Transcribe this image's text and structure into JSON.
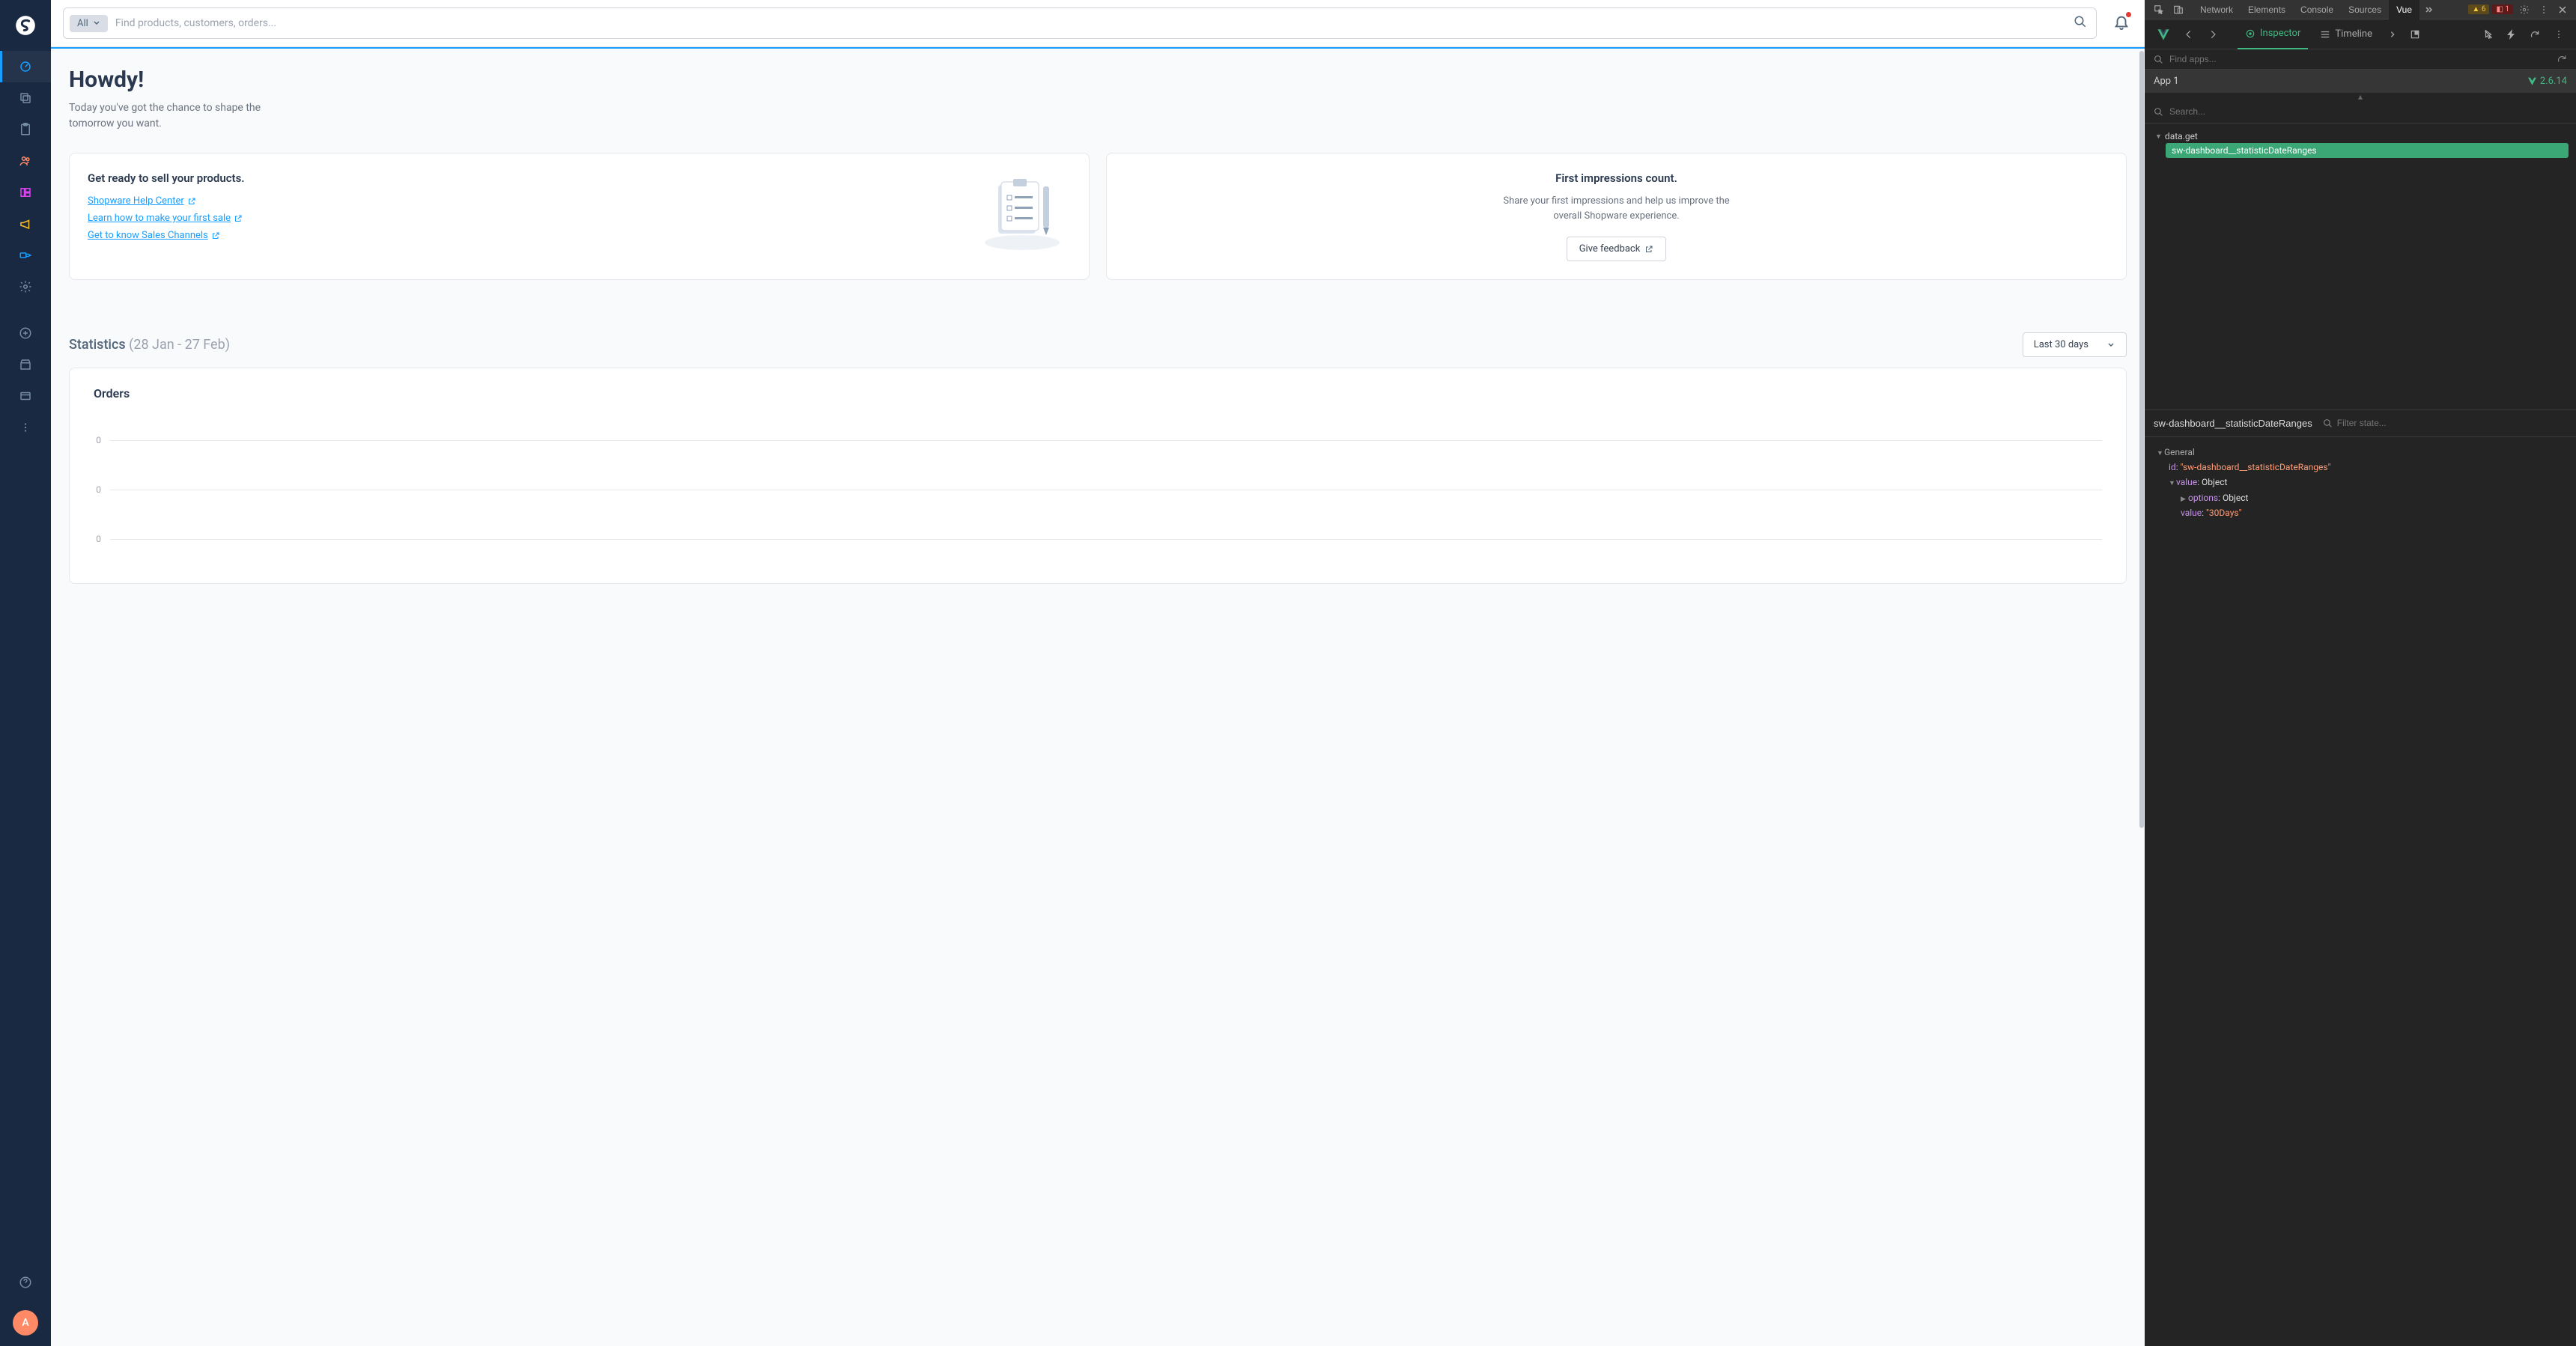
{
  "search": {
    "filter": "All",
    "placeholder": "Find products, customers, orders..."
  },
  "avatar": "A",
  "greeting": {
    "title": "Howdy!",
    "subtitle": "Today you've got the chance to shape the tomorrow you want."
  },
  "card_ready": {
    "title": "Get ready to sell your products.",
    "links": [
      "Shopware Help Center ",
      "Learn how to make your first sale ",
      "Get to know Sales Channels "
    ]
  },
  "card_feedback": {
    "title": "First impressions count.",
    "body": "Share your first impressions and help us improve the overall Shopware experience.",
    "button": "Give feedback"
  },
  "stats": {
    "label": "Statistics",
    "range": "(28 Jan - 27 Feb)",
    "select": "Last 30 days"
  },
  "chart": {
    "title": "Orders"
  },
  "chart_data": {
    "type": "line",
    "title": "Orders",
    "xlabel": "",
    "ylabel": "",
    "ylim": [
      0,
      0
    ],
    "y_ticks": [
      0,
      0,
      0
    ],
    "categories": [],
    "values": []
  },
  "devtools": {
    "tabs": [
      "Network",
      "Elements",
      "Console",
      "Sources",
      "Vue"
    ],
    "active_tab": "Vue",
    "warn_count": "6",
    "err_count": "1",
    "vue_tabs": {
      "inspector": "Inspector",
      "timeline": "Timeline"
    },
    "find_apps_placeholder": "Find apps...",
    "app_name": "App 1",
    "app_version": "2.6.14",
    "tree_search_placeholder": "Search...",
    "tree_parent": "data.get",
    "tree_selected": "sw-dashboard__statisticDateRanges",
    "state_title": "sw-dashboard__statisticDateRanges",
    "filter_state_placeholder": "Filter state...",
    "state": {
      "general_label": "General",
      "id_key": "id",
      "id_val": "\"sw-dashboard__statisticDateRanges\"",
      "value_key": "value",
      "value_type": "Object",
      "options_key": "options",
      "options_type": "Object",
      "inner_value_key": "value",
      "inner_value_val": "\"30Days\""
    }
  }
}
